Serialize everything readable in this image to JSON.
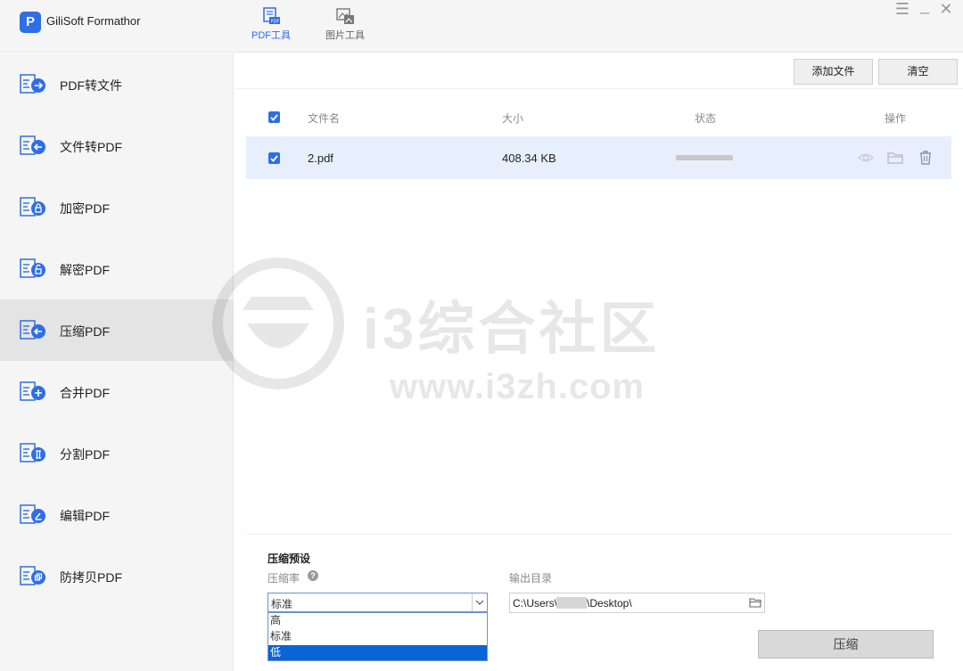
{
  "app": {
    "title": "GiliSoft Formathor",
    "logo_letter": "P",
    "window_controls": [
      "☰",
      "_",
      "✕"
    ]
  },
  "top_tabs": [
    {
      "label": "PDF工具",
      "active": true,
      "icon": "pdf-tool-icon"
    },
    {
      "label": "图片工具",
      "active": false,
      "icon": "image-tool-icon"
    }
  ],
  "sidebar": {
    "items": [
      {
        "label": "PDF转文件",
        "icon": "pdf-to-file-icon",
        "active": false
      },
      {
        "label": "文件转PDF",
        "icon": "file-to-pdf-icon",
        "active": false
      },
      {
        "label": "加密PDF",
        "icon": "encrypt-pdf-icon",
        "active": false
      },
      {
        "label": "解密PDF",
        "icon": "decrypt-pdf-icon",
        "active": false
      },
      {
        "label": "压缩PDF",
        "icon": "compress-pdf-icon",
        "active": true
      },
      {
        "label": "合并PDF",
        "icon": "merge-pdf-icon",
        "active": false
      },
      {
        "label": "分割PDF",
        "icon": "split-pdf-icon",
        "active": false
      },
      {
        "label": "编辑PDF",
        "icon": "edit-pdf-icon",
        "active": false
      },
      {
        "label": "防拷贝PDF",
        "icon": "copy-protect-pdf-icon",
        "active": false
      }
    ]
  },
  "toolbar": {
    "add_file_label": "添加文件",
    "clear_label": "清空"
  },
  "table": {
    "headers": {
      "name": "文件名",
      "size": "大小",
      "status": "状态",
      "actions": "操作"
    },
    "rows": [
      {
        "name": "2.pdf",
        "size": "408.34 KB",
        "checked": true
      }
    ]
  },
  "watermark": {
    "text": "i3综合社区",
    "url": "www.i3zh.com"
  },
  "settings": {
    "title": "压缩预设",
    "rate_label": "压缩率",
    "help_glyph": "?",
    "rate_value": "标准",
    "rate_options": [
      "高",
      "标准",
      "低"
    ],
    "rate_highlighted": "低",
    "output_label": "输出目录",
    "output_prefix": "C:\\Users\\",
    "output_suffix": "\\Desktop\\",
    "compress_label": "压缩"
  },
  "colors": {
    "accent": "#2f6ee5",
    "selected_row": "#e8effc",
    "dropdown_selected": "#0a64d6"
  }
}
